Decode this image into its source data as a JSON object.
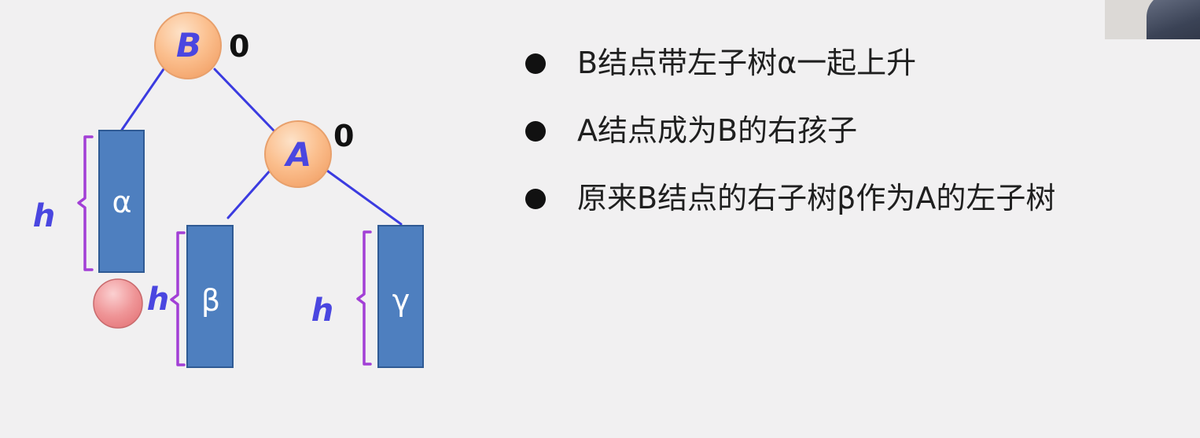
{
  "diagram": {
    "nodes": {
      "B": {
        "label": "B",
        "balance": "0"
      },
      "A": {
        "label": "A",
        "balance": "0"
      }
    },
    "subtrees": {
      "alpha": {
        "label": "α",
        "height_label": "h"
      },
      "beta": {
        "label": "β",
        "height_label": "h"
      },
      "gamma": {
        "label": "γ",
        "height_label": "h"
      }
    },
    "colors": {
      "node_fill": "#fbbf8e",
      "node_stroke": "#e8a06c",
      "node_label": "#4a46e0",
      "edge": "#3b3be0",
      "subtree_fill": "#4e7fbf",
      "subtree_stroke": "#2f5a94",
      "brace": "#a23fd6",
      "height_label": "#4a46e0",
      "inserted_node": "#ec8c8e"
    }
  },
  "bullets": [
    "B结点带左子树α一起上升",
    "A结点成为B的右孩子",
    "原来B结点的右子树β作为A的左子树"
  ]
}
